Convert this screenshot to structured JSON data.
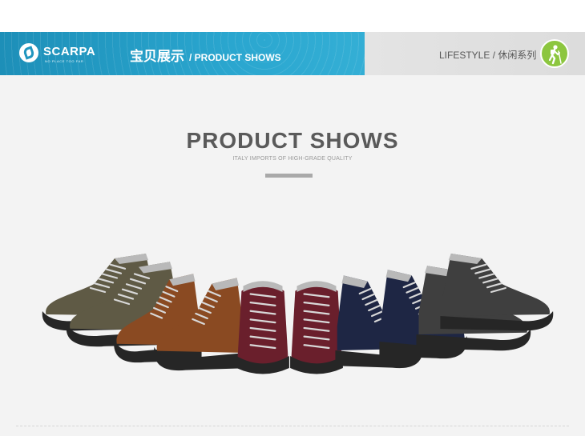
{
  "header": {
    "brand": "SCARPA",
    "tagline": "NO PLACE TOO FAR",
    "title_cn": "宝贝展示",
    "title_en": "/ PRODUCT  SHOWS",
    "category": "LIFESTYLE / 休闲系列",
    "category_icon": "hiker-icon"
  },
  "section": {
    "title": "PRODUCT  SHOWS",
    "subtitle": "ITALY IMPORTS OF HIGH-GRADE QUALITY"
  },
  "product": {
    "image_alt": "",
    "colorways": [
      "olive",
      "brown",
      "burgundy",
      "navy",
      "charcoal"
    ],
    "colors": {
      "olive": "#5f5a45",
      "brown": "#8a4a22",
      "burgundy": "#6a1f2c",
      "navy": "#1e2644",
      "charcoal": "#3f3f3f",
      "sole": "#262626",
      "lining": "#b9b9b9",
      "lace": "#d8d8d8"
    }
  }
}
